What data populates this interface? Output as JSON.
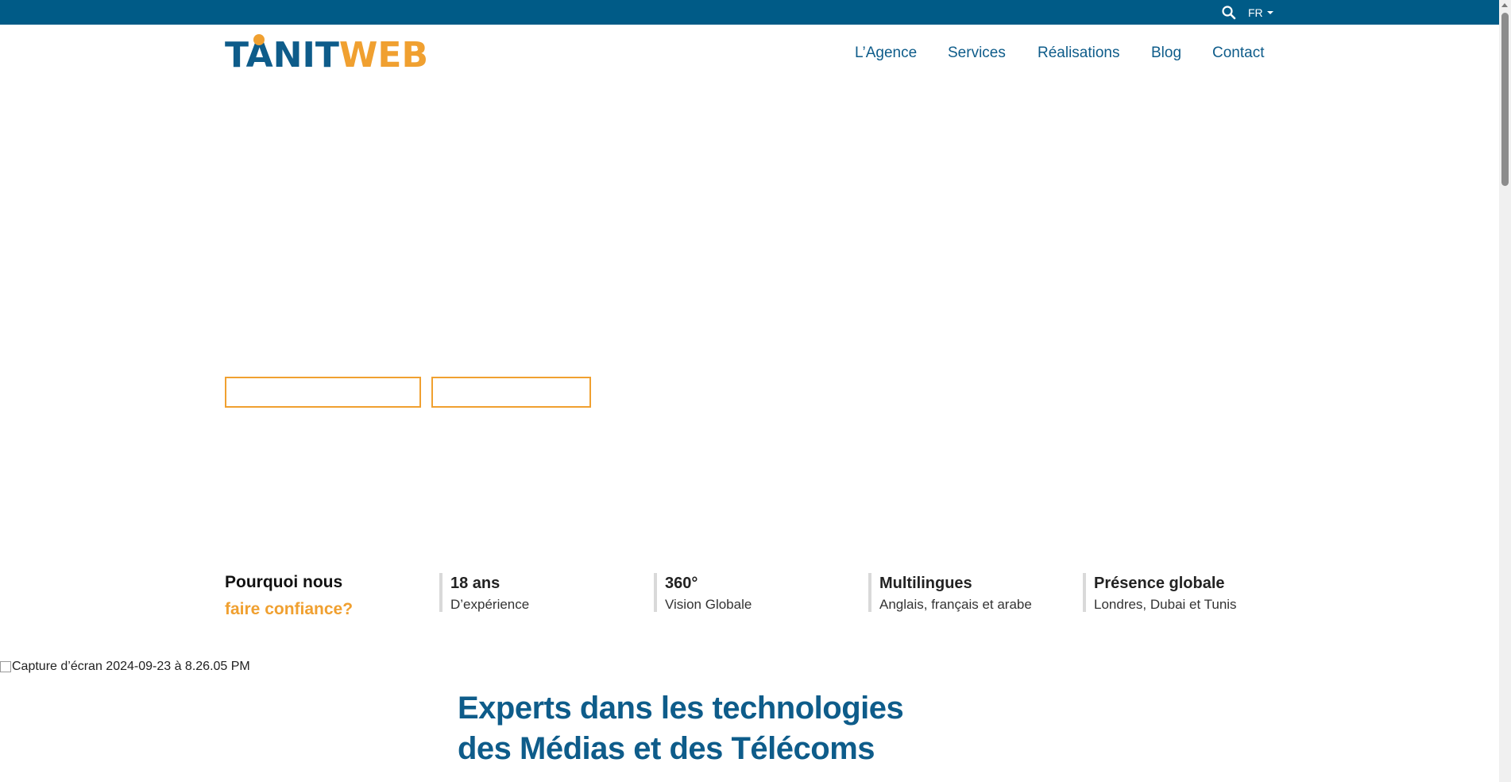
{
  "topbar": {
    "search_icon": "search-icon",
    "language": "FR"
  },
  "logo": {
    "part1": "TANIT",
    "part2": "WEB",
    "registered": "®"
  },
  "nav": {
    "items": [
      {
        "label": "L’Agence"
      },
      {
        "label": "Services"
      },
      {
        "label": "Réalisations"
      },
      {
        "label": "Blog"
      },
      {
        "label": "Contact"
      }
    ]
  },
  "hero": {
    "buttons": [
      {
        "label": ""
      },
      {
        "label": ""
      }
    ]
  },
  "why": {
    "title_line1": "Pourquoi nous",
    "title_line2": "faire confiance?",
    "stats": [
      {
        "value": "18 ans",
        "desc": "D’expérience"
      },
      {
        "value": "360°",
        "desc": "Vision Globale"
      },
      {
        "value": "Multilingues",
        "desc": "Anglais, français et arabe"
      },
      {
        "value": "Présence globale",
        "desc": "Londres, Dubai et Tunis"
      }
    ]
  },
  "image": {
    "alt": "Capture d’écran 2024-09-23 à 8.26.05 PM"
  },
  "experts": {
    "line1": "Experts dans les technologies",
    "line2": "des Médias et des Télécoms"
  },
  "colors": {
    "brand_blue": "#005b87",
    "brand_orange": "#f0a030"
  }
}
